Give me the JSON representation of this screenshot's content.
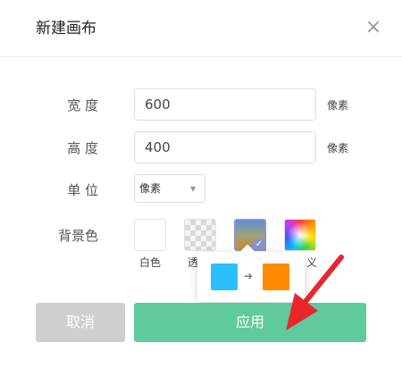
{
  "dialog": {
    "title": "新建画布",
    "close_icon": "×"
  },
  "form": {
    "width": {
      "label": "宽 度",
      "value": "600",
      "unit": "像素"
    },
    "height": {
      "label": "高 度",
      "value": "400",
      "unit": "像素"
    },
    "unit": {
      "label": "单 位",
      "selected": "像素",
      "arrow": "▼"
    },
    "background": {
      "label": "背景色",
      "options": [
        {
          "label": "白色"
        },
        {
          "label": "透"
        },
        {
          "label": ""
        },
        {
          "label": "义"
        }
      ],
      "selected_check": "✓",
      "gradient_popover": {
        "from_color": "#2bbfff",
        "to_color": "#ff8a00",
        "arrow": "➜"
      }
    }
  },
  "buttons": {
    "cancel": "取消",
    "apply": "应用"
  },
  "colors": {
    "apply": "#5fcb9d",
    "cancel": "#cfcfcf",
    "annotation_arrow": "#e8262c"
  }
}
